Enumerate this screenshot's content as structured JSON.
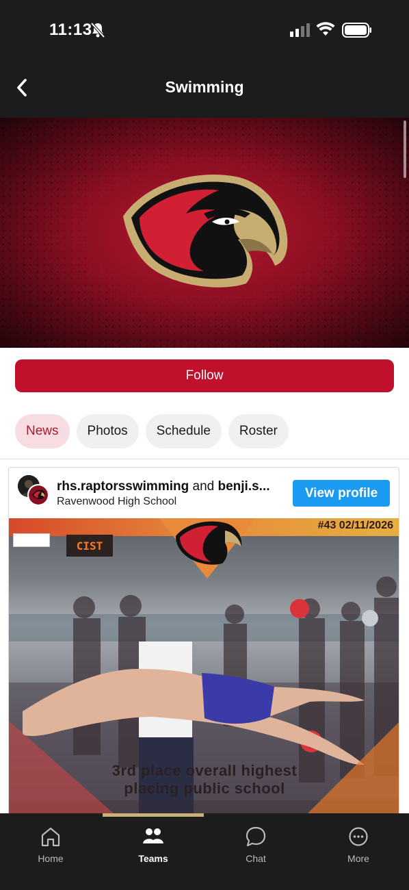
{
  "status_bar": {
    "time": "11:13",
    "icons": [
      "bell-slash-icon",
      "cell-signal-icon",
      "wifi-icon",
      "battery-icon"
    ]
  },
  "nav": {
    "title": "Swimming",
    "back_icon": "chevron-left-icon"
  },
  "hero": {
    "logo": "raptor-head-logo"
  },
  "follow_button": "Follow",
  "tabs": [
    {
      "label": "News",
      "active": true
    },
    {
      "label": "Photos",
      "active": false
    },
    {
      "label": "Schedule",
      "active": false
    },
    {
      "label": "Roster",
      "active": false
    }
  ],
  "post": {
    "author_primary": "rhs.raptorsswimming",
    "joiner": "and",
    "author_secondary": "benji.s...",
    "school": "Ravenwood High School",
    "view_profile_label": "View profile",
    "image": {
      "tag": "#43 02/11/2026",
      "scoreboard": "CIST",
      "caption_line1": "3rd place overall highest",
      "caption_line2": "placing public school"
    }
  },
  "bottom_tabs": [
    {
      "label": "Home",
      "icon": "home-icon",
      "active": false
    },
    {
      "label": "Teams",
      "icon": "teams-icon",
      "active": true
    },
    {
      "label": "Chat",
      "icon": "chat-icon",
      "active": false
    },
    {
      "label": "More",
      "icon": "more-icon",
      "active": false
    }
  ],
  "colors": {
    "brand_red": "#c0102c",
    "tab_active_bg": "#f7dde1",
    "view_profile_blue": "#1a9af0",
    "dark_bar": "#1c1c1c"
  }
}
